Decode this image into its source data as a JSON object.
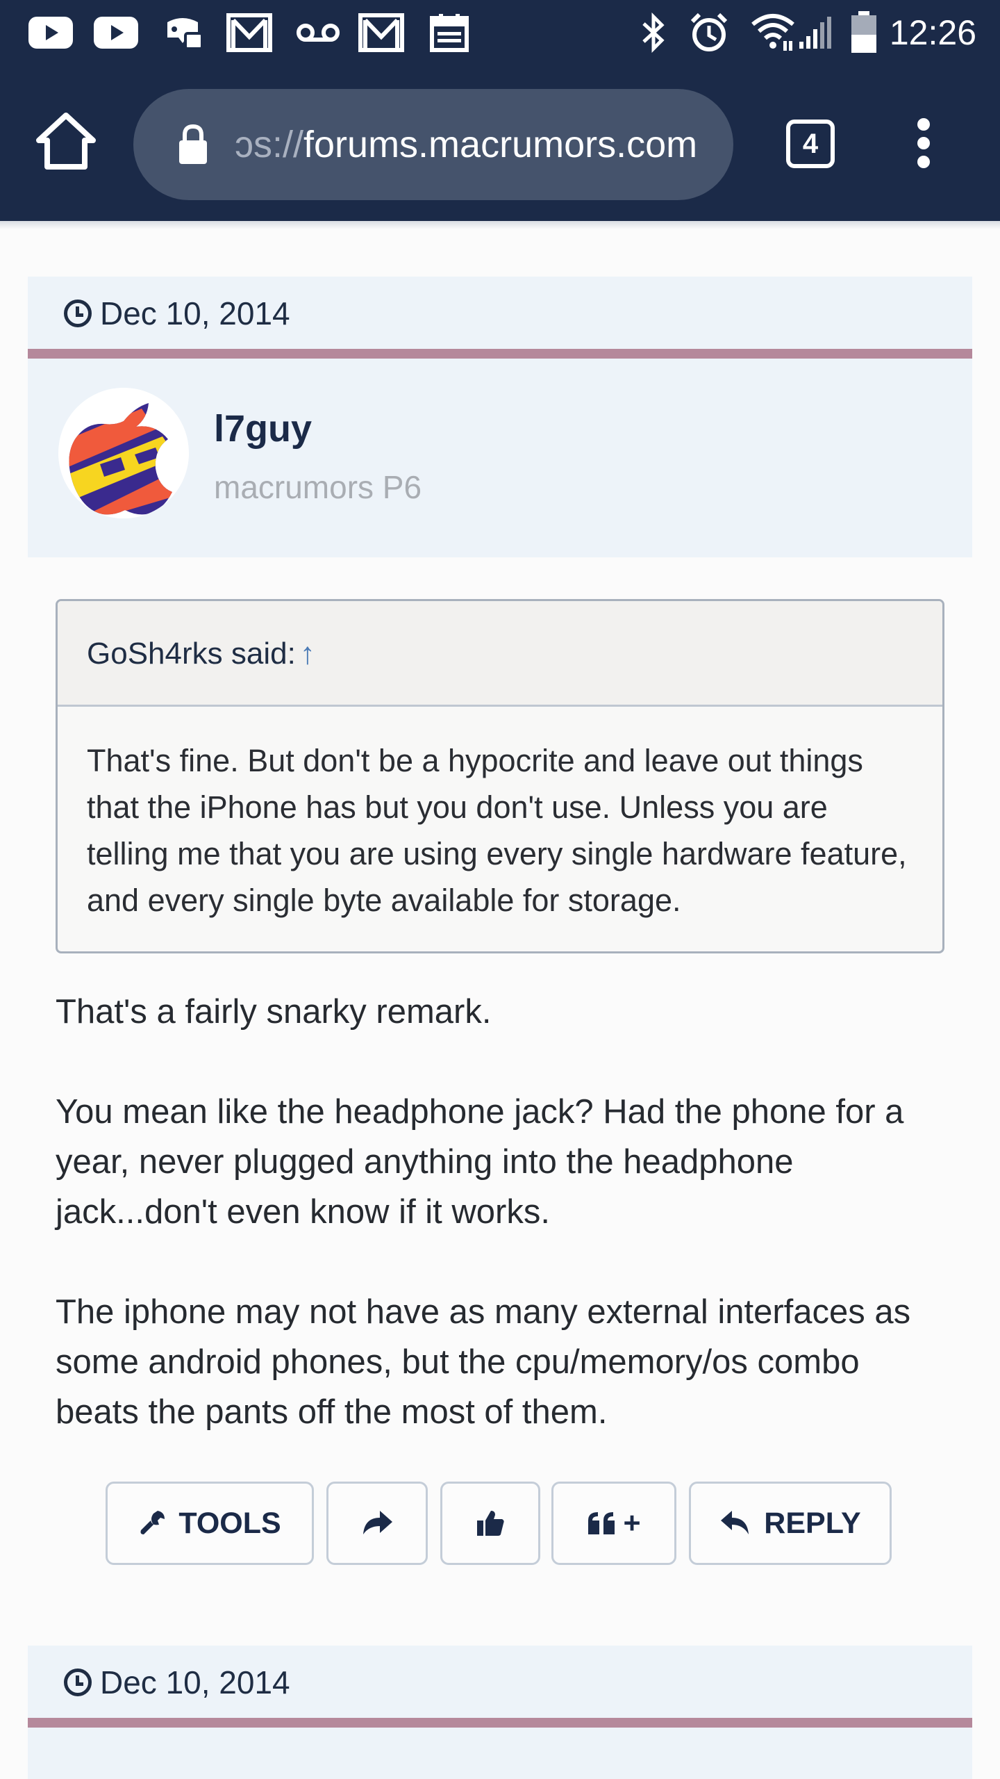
{
  "status_bar": {
    "time": "12:26",
    "icons": [
      "youtube-icon",
      "youtube-icon",
      "game-controller-icon",
      "gmail-icon",
      "voicemail-icon",
      "gmail-icon",
      "calendar-icon",
      "bluetooth-icon",
      "alarm-icon",
      "wifi-icon",
      "signal-icon",
      "battery-icon"
    ]
  },
  "browser": {
    "url_prefix": "ɔs://",
    "url_host": "forums.macrumors.com",
    "tab_count": "4"
  },
  "post": {
    "date": "Dec 10, 2014",
    "author": {
      "username": "l7guy",
      "title": "macrumors P6"
    },
    "quote": {
      "attribution": "GoSh4rks said:",
      "arrow": "↑",
      "text": "That's fine. But don't be a hypocrite and leave out things that the iPhone has but you don't use. Unless you are telling me that you are using every single hardware feature, and every single byte available for storage."
    },
    "body": [
      "That's a fairly snarky remark.",
      "You mean like the headphone jack? Had the phone for a year, never plugged anything into the headphone jack...don't even know if it works.",
      "The iphone may not have as many external interfaces as some android phones, but the cpu/memory/os combo beats the pants off the most of them."
    ],
    "actions": {
      "tools_label": "TOOLS",
      "multiquote_label": "+",
      "reply_label": "REPLY"
    }
  },
  "next_post": {
    "date": "Dec 10, 2014"
  },
  "colors": {
    "header_bg": "#1b2a48",
    "url_box": "#45536c",
    "post_header_bg": "#edf3f9",
    "divider": "#b5889b",
    "quote_head_bg": "#f2f1ef"
  }
}
